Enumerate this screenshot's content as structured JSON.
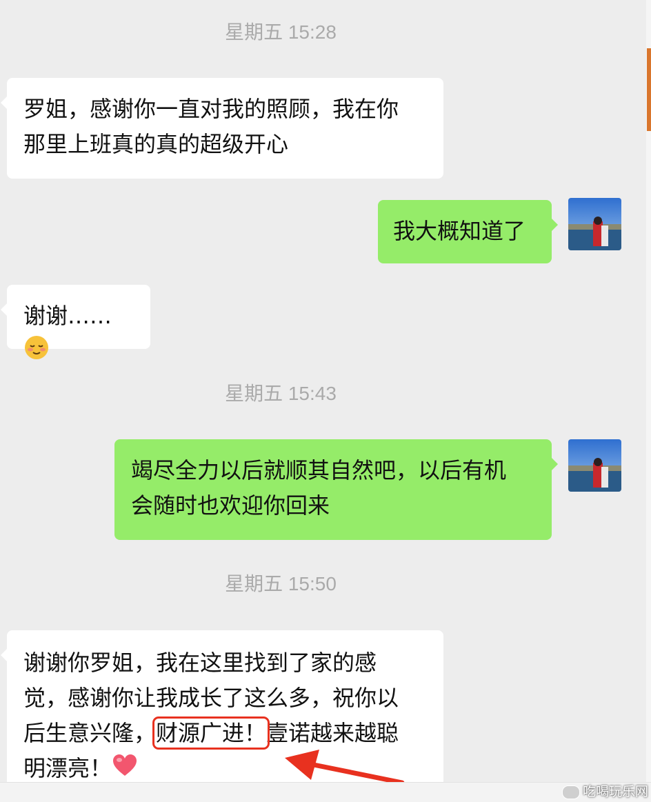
{
  "timestamps": {
    "t1": "星期五 15:28",
    "t2": "星期五 15:43",
    "t3": "星期五 15:50"
  },
  "messages": {
    "m1": {
      "line1": "罗姐，感谢你一直对我的照顾，我在你",
      "line2": "那里上班真的真的超级开心"
    },
    "m2": {
      "text": "我大概知道了"
    },
    "m3": {
      "text": "谢谢……",
      "emoji": "smiling-face-emoji"
    },
    "m4": {
      "line1": "竭尽全力以后就顺其自然吧，以后有机",
      "line2": "会随时也欢迎你回来"
    },
    "m5": {
      "line1": "谢谢你罗姐，我在这里找到了家的感",
      "line2": "觉，感谢你让我成长了这么多，祝你以",
      "line3_before": "后生意兴隆，",
      "line3_highlight": "财源广进！",
      "line3_after": "壹诺越来越聪",
      "line4": "明漂亮！",
      "emoji": "heart-emoji"
    }
  },
  "annotation": {
    "box_color": "#e8311f",
    "arrow_color": "#e8311f"
  },
  "watermark": {
    "text": "吃喝玩乐网"
  },
  "colors": {
    "background": "#ededed",
    "incoming": "#ffffff",
    "outgoing": "#95ec69",
    "timestamp": "#aaaaaa"
  }
}
